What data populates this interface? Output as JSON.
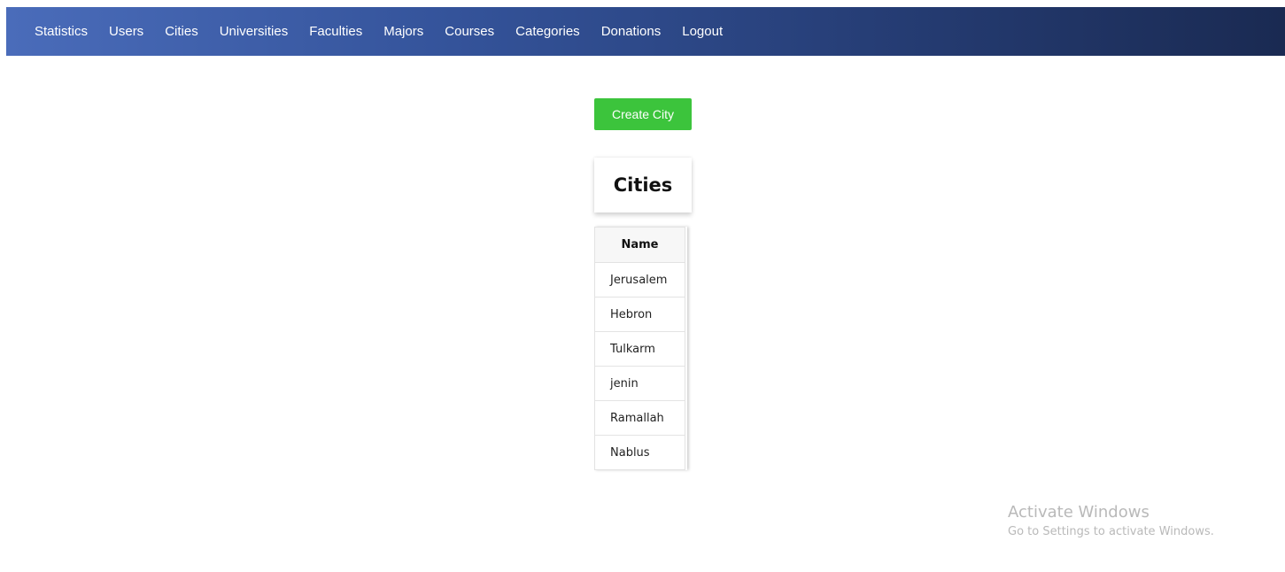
{
  "nav": {
    "items": [
      {
        "label": "Statistics"
      },
      {
        "label": "Users"
      },
      {
        "label": "Cities"
      },
      {
        "label": "Universities"
      },
      {
        "label": "Faculties"
      },
      {
        "label": "Majors"
      },
      {
        "label": "Courses"
      },
      {
        "label": "Categories"
      },
      {
        "label": "Donations"
      },
      {
        "label": "Logout"
      }
    ],
    "gradient_start": "#4a6cba",
    "gradient_end": "#1a2a52"
  },
  "actions": {
    "create_label": "Create City",
    "create_color": "#3cc43c"
  },
  "page": {
    "title": "Cities"
  },
  "table": {
    "header": "Name",
    "rows": [
      "Jerusalem",
      "Hebron",
      "Tulkarm",
      "jenin",
      "Ramallah",
      "Nablus"
    ]
  },
  "watermark": {
    "title": "Activate Windows",
    "subtitle": "Go to Settings to activate Windows."
  }
}
